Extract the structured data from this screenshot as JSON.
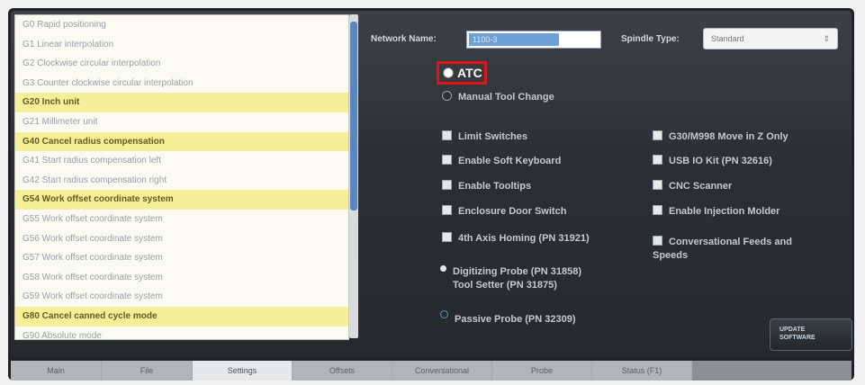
{
  "gcode_list": {
    "items": [
      {
        "text": "G0  Rapid positioning",
        "highlight": false
      },
      {
        "text": "G1  Linear interpolation",
        "highlight": false
      },
      {
        "text": "G2  Clockwise circular interpolation",
        "highlight": false
      },
      {
        "text": "G3  Counter clockwise circular interpolation",
        "highlight": false
      },
      {
        "text": "G20  Inch unit",
        "highlight": true
      },
      {
        "text": "G21  Millimeter unit",
        "highlight": false
      },
      {
        "text": "G40  Cancel radius compensation",
        "highlight": true
      },
      {
        "text": "G41  Start radius compensation left",
        "highlight": false
      },
      {
        "text": "G42  Start radius compensation right",
        "highlight": false
      },
      {
        "text": "G54  Work offset coordinate system",
        "highlight": true
      },
      {
        "text": "G55  Work offset coordinate system",
        "highlight": false
      },
      {
        "text": "G56  Work offset coordinate system",
        "highlight": false
      },
      {
        "text": "G57  Work offset coordinate system",
        "highlight": false
      },
      {
        "text": "G58  Work offset coordinate system",
        "highlight": false
      },
      {
        "text": "G59  Work offset coordinate system",
        "highlight": false
      },
      {
        "text": "G80  Cancel canned cycle mode",
        "highlight": true
      },
      {
        "text": "G90  Absolute mode",
        "highlight": false
      }
    ]
  },
  "network": {
    "label": "Network Name:",
    "value": "1100-3"
  },
  "spindle": {
    "label": "Spindle Type:",
    "value": "Standard"
  },
  "tool_change": {
    "atc_label": "ATC",
    "manual_label": "Manual Tool Change"
  },
  "options_left": [
    {
      "label": "Limit Switches",
      "checked": true
    },
    {
      "label": "Enable Soft Keyboard",
      "checked": false
    },
    {
      "label": "Enable Tooltips",
      "checked": true
    },
    {
      "label": "Enclosure Door Switch",
      "checked": false
    },
    {
      "label": "4th Axis Homing (PN 31921)",
      "checked": false
    }
  ],
  "options_right": [
    {
      "label": "G30/M998 Move in Z Only",
      "checked": false
    },
    {
      "label": "USB IO Kit (PN 32616)",
      "checked": false
    },
    {
      "label": "CNC Scanner",
      "checked": false
    },
    {
      "label": "Enable Injection Molder",
      "checked": false
    },
    {
      "label": "Conversational Feeds and Speeds",
      "checked": true
    }
  ],
  "probe": {
    "digitizing_line1": "Digitizing Probe (PN 31858)",
    "digitizing_line2": "Tool Setter (PN 31875)",
    "passive": "Passive Probe (PN 32309)"
  },
  "manager_button": {
    "line1": "UPDATE",
    "line2": "SOFTWARE"
  },
  "tabs": [
    {
      "label": "Main",
      "active": false
    },
    {
      "label": "File",
      "active": false
    },
    {
      "label": "Settings",
      "active": true
    },
    {
      "label": "Offsets",
      "active": false
    },
    {
      "label": "Conversational",
      "active": false
    },
    {
      "label": "Probe",
      "active": false
    },
    {
      "label": "Status (F1)",
      "active": false
    }
  ],
  "colors": {
    "highlight": "#f5ef9a",
    "atc_outline": "#e0141a",
    "accent": "#5b86c4"
  }
}
